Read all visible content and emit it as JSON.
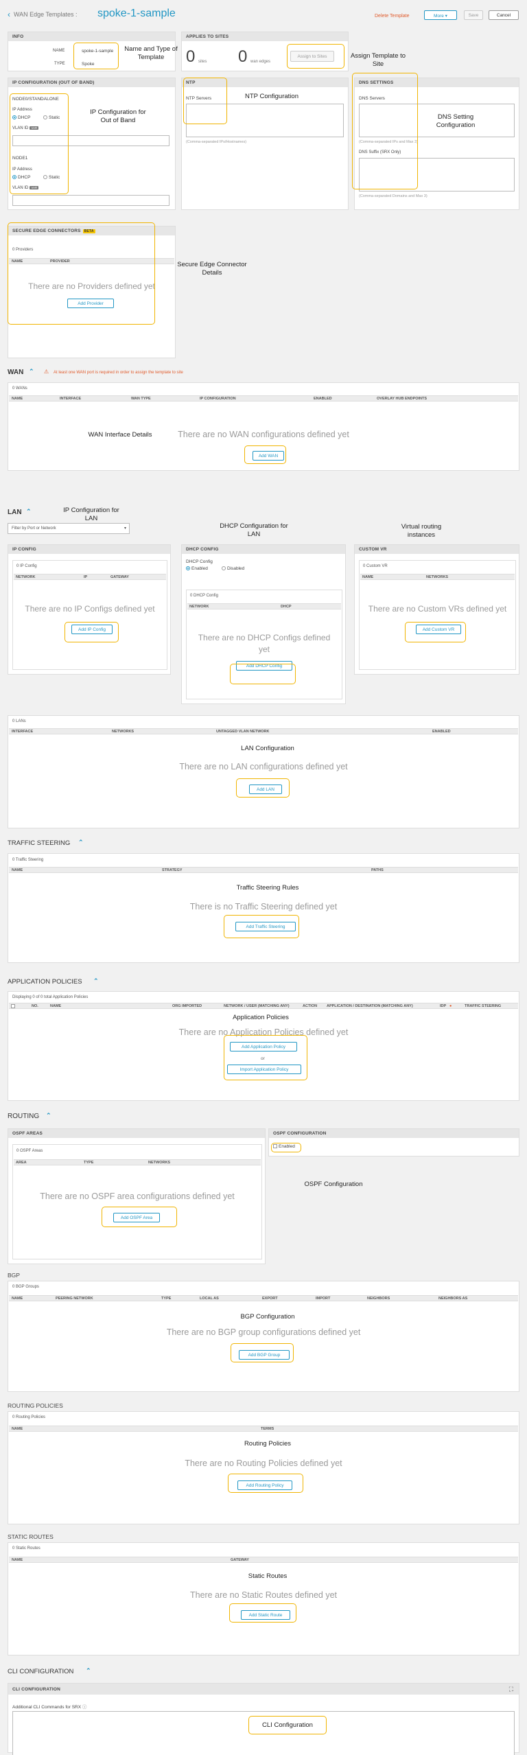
{
  "header": {
    "breadcrumb": "WAN Edge Templates :",
    "template_name": "spoke-1-sample",
    "delete_label": "Delete Template",
    "more_label": "More",
    "save_label": "Save",
    "cancel_label": "Cancel"
  },
  "info": {
    "title": "INFO",
    "name_label": "NAME",
    "name_value": "spoke-1-sample",
    "type_label": "TYPE",
    "type_value": "Spoke",
    "annotation": "Name and Type of Template"
  },
  "applies": {
    "title": "APPLIES TO SITES",
    "sites_count": "0",
    "sites_label": "sites",
    "edges_count": "0",
    "edges_label": "wan edges",
    "assign_label": "Assign to Sites",
    "annotation": "Assign Template to Site"
  },
  "ip_oob": {
    "title": "IP CONFIGURATION (OUT OF BAND)",
    "node0": "NODE0/STANDALONE",
    "ip_label": "IP Address",
    "dhcp": "DHCP",
    "static": "Static",
    "vlan_label": "VLAN ID",
    "vlan_badge": "VAR",
    "node1": "NODE1",
    "annotation": "IP Configuration for Out of Band"
  },
  "ntp": {
    "title": "NTP",
    "servers_label": "NTP Servers",
    "hint": "(Comma-separated IPs/Hostnames)",
    "annotation": "NTP Configuration"
  },
  "dns": {
    "title": "DNS SETTINGS",
    "servers_label": "DNS Servers",
    "servers_hint": "(Comma-separated IPs and Max 3)",
    "suffix_label": "DNS Suffix (SRX Only)",
    "suffix_hint": "(Comma-separated Domains and Max 3)",
    "annotation": "DNS Setting Configuration"
  },
  "sec": {
    "title": "SECURE EDGE CONNECTORS",
    "beta": "BETA",
    "count": "0 Providers",
    "col_name": "NAME",
    "col_provider": "PROVIDER",
    "empty": "There are no Providers defined yet",
    "add_label": "Add Provider",
    "annotation": "Secure Edge Connector Details"
  },
  "wan": {
    "title": "WAN",
    "warning": "At least one WAN port is required in order to assign the template to site",
    "count": "0 WANs",
    "cols": [
      "NAME",
      "INTERFACE",
      "WAN TYPE",
      "IP CONFIGURATION",
      "ENABLED",
      "OVERLAY HUB ENDPOINTS"
    ],
    "empty": "There are no WAN configurations defined yet",
    "add_label": "Add WAN",
    "annotation": "WAN Interface Details"
  },
  "lan": {
    "title": "LAN",
    "filter_placeholder": "Filter by Port or Network",
    "annotation_ip": "IP Configuration for LAN",
    "annotation_dhcp": "DHCP Configuration for LAN",
    "annotation_vr": "Virtual routing instances",
    "ipconfig": {
      "title": "IP CONFIG",
      "count": "0 IP Config",
      "cols": [
        "NETWORK",
        "IP",
        "GATEWAY"
      ],
      "empty": "There are no IP Configs defined yet",
      "add_label": "Add IP Config"
    },
    "dhcp": {
      "title": "DHCP CONFIG",
      "label": "DHCP Config",
      "enabled": "Enabled",
      "disabled": "Disabled",
      "count": "0 DHCP Config",
      "cols": [
        "NETWORK",
        "DHCP"
      ],
      "empty1": "There are no DHCP Configs defined",
      "empty2": "yet",
      "add_label": "Add DHCP Config"
    },
    "vr": {
      "title": "CUSTOM VR",
      "count": "0 Custom VR",
      "cols": [
        "NAME",
        "NETWORKS"
      ],
      "empty": "There are no Custom VRs defined yet",
      "add_label": "Add Custom VR"
    },
    "lans": {
      "count": "0 LANs",
      "cols": [
        "INTERFACE",
        "NETWORKS",
        "UNTAGGED VLAN NETWORK",
        "ENABLED"
      ],
      "annotation": "LAN Configuration",
      "empty": "There are no LAN configurations defined yet",
      "add_label": "Add LAN"
    }
  },
  "traffic": {
    "title": "TRAFFIC STEERING",
    "count": "0 Traffic Steering",
    "cols": [
      "NAME",
      "STRATEGY",
      "PATHS"
    ],
    "annotation": "Traffic Steering Rules",
    "empty": "There is no Traffic Steering defined yet",
    "add_label": "Add Traffic Steering"
  },
  "app": {
    "title": "APPLICATION POLICIES",
    "count": "Displaying 0 of 0 total Application Policies",
    "cols": [
      "NO.",
      "NAME",
      "ORG IMPORTED",
      "NETWORK / USER (MATCHING ANY)",
      "ACTION",
      "APPLICATION / DESTINATION (MATCHING ANY)",
      "IDP",
      "TRAFFIC STEERING"
    ],
    "annotation": "Application Policies",
    "empty": "There are no Application Policies defined yet",
    "add_label": "Add Application Policy",
    "or": "or",
    "import_label": "Import Application Policy"
  },
  "routing": {
    "title": "ROUTING",
    "ospf_areas": {
      "title": "OSPF AREAS",
      "count": "0 OSPF Areas",
      "cols": [
        "AREA",
        "TYPE",
        "NETWORKS"
      ],
      "empty": "There are no OSPF area configurations defined yet",
      "add_label": "Add OSPF Area"
    },
    "ospf_config": {
      "title": "OSPF CONFIGURATION",
      "enabled": "Enabled",
      "annotation": "OSPF Configuration"
    }
  },
  "bgp": {
    "title": "BGP",
    "count": "0 BGP Groups",
    "cols": [
      "NAME",
      "PEERING NETWORK",
      "TYPE",
      "LOCAL AS",
      "EXPORT",
      "IMPORT",
      "NEIGHBORS",
      "NEIGHBORS AS"
    ],
    "annotation": "BGP Configuration",
    "empty": "There are no BGP group configurations defined yet",
    "add_label": "Add BGP Group"
  },
  "rpol": {
    "title": "ROUTING POLICIES",
    "count": "0 Routing Policies",
    "cols": [
      "NAME",
      "TERMS"
    ],
    "annotation": "Routing Policies",
    "empty": "There are no Routing Policies defined yet",
    "add_label": "Add Routing Policy"
  },
  "static": {
    "title": "STATIC ROUTES",
    "count": "0 Static Routes",
    "cols": [
      "NAME",
      "GATEWAY"
    ],
    "annotation": "Static Routes",
    "empty": "There are no Static Routes defined yet",
    "add_label": "Add Static Route"
  },
  "cli": {
    "title": "CLI CONFIGURATION",
    "panel_title": "CLI CONFIGURATION",
    "label": "Additional CLI Commands for SRX",
    "annotation": "CLI Configuration"
  },
  "colors": {
    "accent": "#2196c4",
    "highlight": "#f0b400",
    "warning": "#e05a2b"
  }
}
